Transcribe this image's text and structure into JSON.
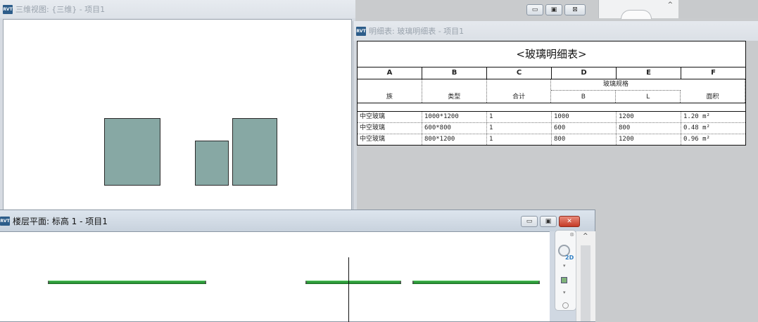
{
  "view3d": {
    "title": "三维视图: {三维} - 项目1",
    "min": "▭",
    "max": "▣",
    "close": "⊠"
  },
  "schedule_window": {
    "title": "明细表: 玻璃明细表 - 项目1",
    "schedule_title": "<玻璃明细表>",
    "columns": [
      "A",
      "B",
      "C",
      "D",
      "E",
      "F"
    ],
    "header": {
      "family": "族",
      "type": "类型",
      "count": "合计",
      "group": "玻璃规格",
      "b": "B",
      "l": "L",
      "area": "面积"
    },
    "rows": [
      [
        "中空玻璃",
        "1000*1200",
        "1",
        "1000",
        "1200",
        "1.20 m²"
      ],
      [
        "中空玻璃",
        "600*800",
        "1",
        "600",
        "800",
        "0.48 m²"
      ],
      [
        "中空玻璃",
        "800*1200",
        "1",
        "800",
        "1200",
        "0.96 m²"
      ]
    ]
  },
  "plan": {
    "title": "楼层平面: 标高 1 - 项目1",
    "min": "▭",
    "max": "▣",
    "close": "✕",
    "nav_label_2d": "2D"
  },
  "strip": {
    "caret": "^"
  },
  "colors": {
    "panel_fill": "#87a8a4",
    "wall_green": "#2e9b3a",
    "close_red": "#c43a26",
    "rvt_blue": "#2d5d8a"
  },
  "icons": [
    "rvt-app-icon",
    "minimize-icon",
    "maximize-icon",
    "close-icon",
    "scroll-up-icon",
    "steering-wheel-icon",
    "zoom-icon"
  ]
}
